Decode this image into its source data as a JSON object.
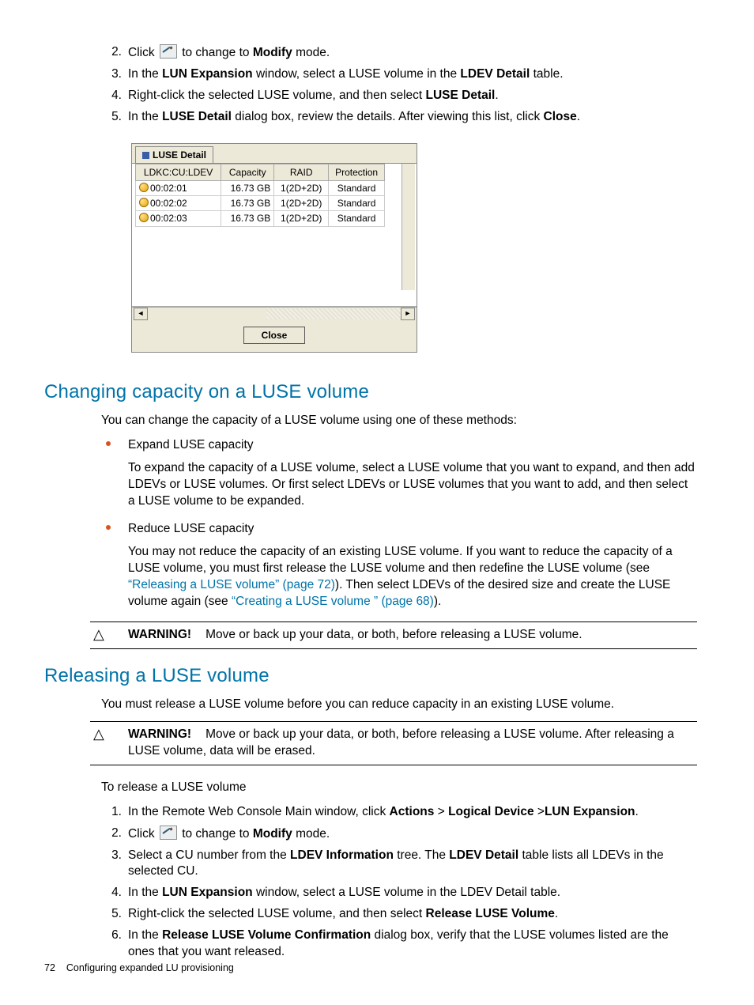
{
  "top_steps": [
    {
      "n": "2.",
      "pre": "Click ",
      "icon": true,
      "post_a": " to change to ",
      "bold_a": "Modify",
      "post_b": " mode."
    },
    {
      "n": "3.",
      "text_parts": [
        "In the ",
        "LUN Expansion",
        " window, select a LUSE volume in the ",
        "LDEV Detail",
        " table."
      ]
    },
    {
      "n": "4.",
      "text_parts": [
        "Right-click the selected LUSE volume, and then select ",
        "LUSE Detail",
        "."
      ]
    },
    {
      "n": "5.",
      "text_parts": [
        "In the ",
        "LUSE Detail",
        " dialog box, review the details. After viewing this list, click ",
        "Close",
        "."
      ]
    }
  ],
  "dialog": {
    "tab": "LUSE Detail",
    "headers": [
      "LDKC:CU:LDEV",
      "Capacity",
      "RAID",
      "Protection"
    ],
    "rows": [
      [
        "00:02:01",
        "16.73 GB",
        "1(2D+2D)",
        "Standard"
      ],
      [
        "00:02:02",
        "16.73 GB",
        "1(2D+2D)",
        "Standard"
      ],
      [
        "00:02:03",
        "16.73 GB",
        "1(2D+2D)",
        "Standard"
      ]
    ],
    "close": "Close"
  },
  "sec1": {
    "title": "Changing capacity on a LUSE volume",
    "intro": "You can change the capacity of a LUSE volume using one of these methods:",
    "b1_title": "Expand LUSE capacity",
    "b1_body": "To expand the capacity of a LUSE volume, select a LUSE volume that you want to expand, and then add LDEVs or LUSE volumes. Or first select LDEVs or LUSE volumes that you want to add, and then select a LUSE volume to be expanded.",
    "b2_title": "Reduce LUSE capacity",
    "b2_a": "You may not reduce the capacity of an existing LUSE volume. If you want to reduce the capacity of a LUSE volume, you must first release the LUSE volume and then redefine the LUSE volume (see ",
    "b2_link1": "“Releasing a LUSE volume” (page 72)",
    "b2_b": "). Then select LDEVs of the desired size and create the LUSE volume again (see ",
    "b2_link2": "“Creating a LUSE volume ” (page 68)",
    "b2_c": ").",
    "warn_label": "WARNING!",
    "warn_text": "Move or back up your data, or both, before releasing a LUSE volume."
  },
  "sec2": {
    "title": "Releasing a LUSE volume",
    "intro": "You must release a LUSE volume before you can reduce capacity in an existing LUSE volume.",
    "warn_label": "WARNING!",
    "warn_text": "Move or back up your data, or both, before releasing a LUSE volume. After releasing a LUSE volume, data will be erased.",
    "lead": "To release a LUSE volume",
    "steps": {
      "s1": {
        "n": "1.",
        "a": "In the Remote Web Console Main window, click ",
        "b1": "Actions",
        "gt1": " > ",
        "b2": "Logical Device",
        "gt2": " >",
        "b3": "LUN Expansion",
        "end": "."
      },
      "s2": {
        "n": "2.",
        "a": "Click ",
        "b": " to change to ",
        "bold": "Modify",
        "c": " mode."
      },
      "s3": {
        "n": "3.",
        "a": "Select a CU number from the ",
        "b1": "LDEV Information",
        "b": " tree. The ",
        "b2": "LDEV Detail",
        "c": " table lists all LDEVs in the selected CU."
      },
      "s4": {
        "n": "4.",
        "a": "In the ",
        "b1": "LUN Expansion",
        "b": " window, select a LUSE volume in the LDEV Detail table."
      },
      "s5": {
        "n": "5.",
        "a": "Right-click the selected LUSE volume, and then select ",
        "b1": "Release LUSE Volume",
        "b": "."
      },
      "s6": {
        "n": "6.",
        "a": "In the ",
        "b1": "Release LUSE Volume Confirmation",
        "b": " dialog box, verify that the LUSE volumes listed are the ones that you want released."
      }
    }
  },
  "footer": {
    "page": "72",
    "title": "Configuring expanded LU provisioning"
  }
}
